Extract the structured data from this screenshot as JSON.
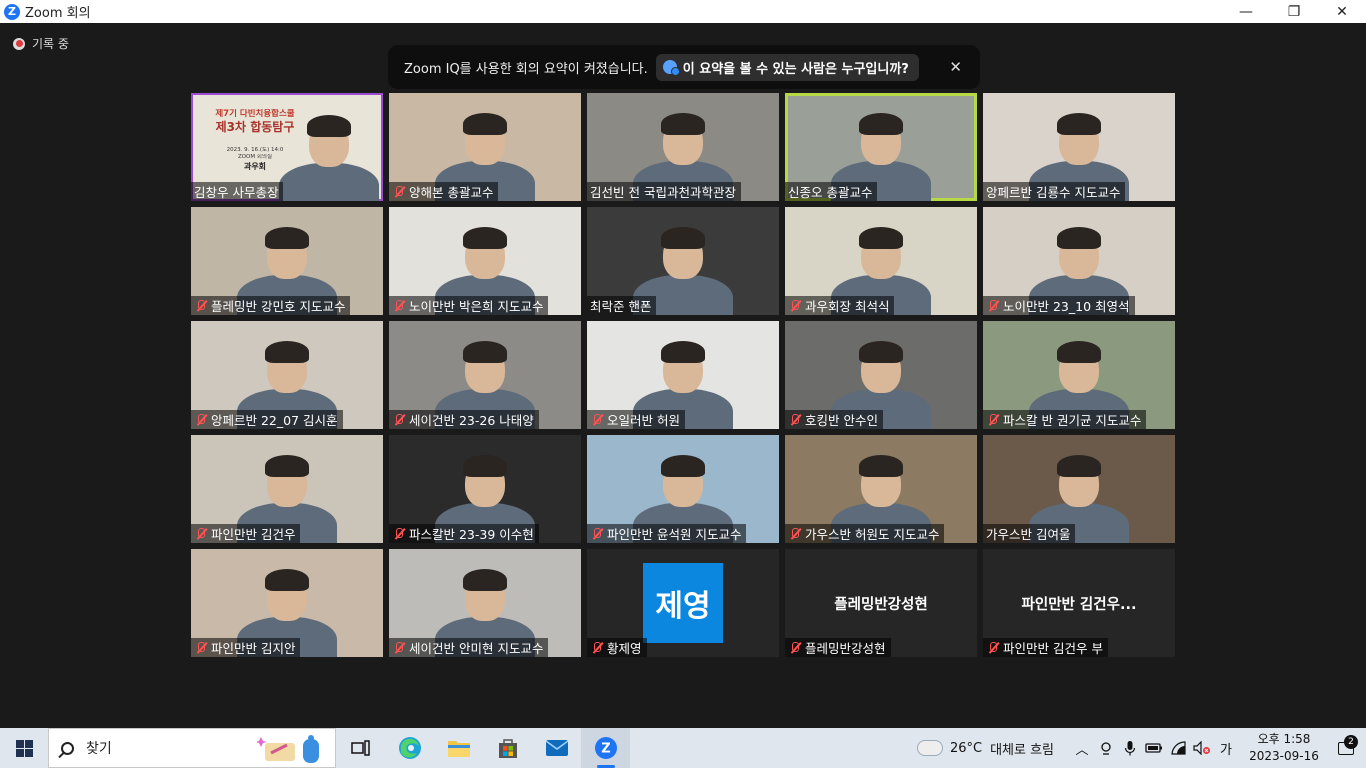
{
  "window": {
    "title": "Zoom 회의",
    "minimize_icon": "minimize-icon",
    "maximize_icon": "restore-icon",
    "close_icon": "close-icon"
  },
  "recording": {
    "label": "기록 중",
    "color": "#e0393e"
  },
  "banner": {
    "message": "Zoom IQ를 사용한 회의 요약이 켜졌습니다.",
    "link": "이 요약을 볼 수 있는 사람은 누구입니까?",
    "close": "✕"
  },
  "participants": [
    {
      "name": "김창우 사무총장",
      "muted": false,
      "spotlight": true,
      "bg": "#e9e4d8",
      "slide": {
        "line1": "제7기 다빈치융합스쿨",
        "line2": "제3차 합동탐구",
        "line3": "2023. 9. 16.(토) 14:0",
        "line4": "ZOOM 회의실",
        "line5": "과우회"
      }
    },
    {
      "name": "양해본 총괄교수",
      "muted": true,
      "bg": "#c9b8a4"
    },
    {
      "name": "김선빈 전 국립과천과학관장",
      "muted": false,
      "bg": "#8c8a85"
    },
    {
      "name": "신종오 총괄교수",
      "muted": false,
      "speaking": true,
      "bg": "#9aa097"
    },
    {
      "name": "앙페르반 김룡수 지도교수",
      "muted": false,
      "bg": "#d9d3cb"
    },
    {
      "name": "플레밍반 강민호 지도교수",
      "muted": true,
      "bg": "#bfb6a6"
    },
    {
      "name": "노이만반 박은희 지도교수",
      "muted": true,
      "bg": "#e3e1dc"
    },
    {
      "name": "최락준 핸폰",
      "muted": false,
      "bg": "#3a3b3a"
    },
    {
      "name": "과우회장 최석식",
      "muted": true,
      "bg": "#d8d4c6"
    },
    {
      "name": "노이만반 23_10 최영석",
      "muted": true,
      "bg": "#d6cfc6"
    },
    {
      "name": "앙페르반 22_07 김시훈",
      "muted": true,
      "bg": "#cfc8bf"
    },
    {
      "name": "세이건반 23-26 나태양",
      "muted": true,
      "bg": "#8d8b88"
    },
    {
      "name": "오일러반 허원",
      "muted": true,
      "bg": "#e4e4e2"
    },
    {
      "name": "호킹반 안수인",
      "muted": true,
      "bg": "#6c6c6a"
    },
    {
      "name": "파스칼 반 권기균 지도교수",
      "muted": true,
      "bg": "#8b9a7e"
    },
    {
      "name": "파인만반 김건우",
      "muted": true,
      "bg": "#cbc4b8"
    },
    {
      "name": "파스칼반 23-39 이수현",
      "muted": true,
      "bg": "#2b2b2b"
    },
    {
      "name": "파인만반 윤석원 지도교수",
      "muted": true,
      "bg": "#9ab7cc"
    },
    {
      "name": "가우스반 허원도 지도교수",
      "muted": true,
      "bg": "#8c7a62"
    },
    {
      "name": "가우스반 김여울",
      "muted": false,
      "bg": "#6b5a4a"
    },
    {
      "name": "파인만반 김지안",
      "muted": true,
      "bg": "#c8b9a8"
    },
    {
      "name": "세이건반 안미현 지도교수",
      "muted": true,
      "bg": "#bdbcb8"
    },
    {
      "name": "황제영",
      "muted": true,
      "avatar": "제영",
      "avatar_color": "#0b87e0"
    },
    {
      "name": "플레밍반강성현",
      "muted": true,
      "display": "플레밍반강성현"
    },
    {
      "name": "파인만반  김건우 부",
      "muted": true,
      "display": "파인만반  김건우..."
    }
  ],
  "taskbar": {
    "search_placeholder": "찾기",
    "apps": [
      "task-view-icon",
      "edge-icon",
      "file-explorer-icon",
      "store-icon",
      "mail-icon",
      "zoom-icon"
    ],
    "weather": {
      "temp": "26°C",
      "desc": "대체로 흐림"
    },
    "ime": "가",
    "time": "오후 1:58",
    "date": "2023-09-16",
    "notifications": "2"
  }
}
